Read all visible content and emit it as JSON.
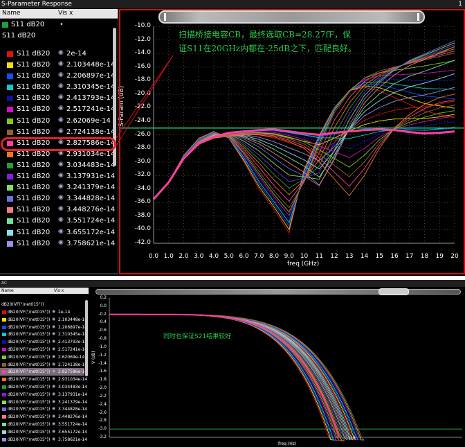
{
  "top_window": {
    "title": "S-Parameter Response",
    "window_number": "1",
    "list_header": {
      "name": "Name",
      "vis": "Vis x"
    },
    "group_top": "S11 dB20",
    "group_sub": "S11 dB20",
    "group_top_marker": "•",
    "rows": [
      {
        "name": "S11 dB20",
        "value": "2e-14",
        "color": "#e01010"
      },
      {
        "name": "S11 dB20",
        "value": "2.103448e-14",
        "color": "#f0e010"
      },
      {
        "name": "S11 dB20",
        "value": "2.206897e-14",
        "color": "#1050ff"
      },
      {
        "name": "S11 dB20",
        "value": "2.310345e-14",
        "color": "#10c8c8"
      },
      {
        "name": "S11 dB20",
        "value": "2.413793e-14",
        "color": "#1010a0"
      },
      {
        "name": "S11 dB20",
        "value": "2.517241e-14",
        "color": "#d010c8"
      },
      {
        "name": "S11 dB20",
        "value": "2.62069e-14",
        "color": "#80c820"
      },
      {
        "name": "S11 dB20",
        "value": "2.724138e-14",
        "color": "#8c6428"
      },
      {
        "name": "S11 dB20",
        "value": "2.827586e-14",
        "color": "#ff40a0",
        "selected": true
      },
      {
        "name": "S11 dB20",
        "value": "2.931034e-14",
        "color": "#f07818"
      },
      {
        "name": "S11 dB20",
        "value": "3.034483e-14",
        "color": "#20a040"
      },
      {
        "name": "S11 dB20",
        "value": "3.137931e-14",
        "color": "#8020e0"
      },
      {
        "name": "S11 dB20",
        "value": "3.241379e-14",
        "color": "#80e060"
      },
      {
        "name": "S11 dB20",
        "value": "3.344828e-14",
        "color": "#7070e0"
      },
      {
        "name": "S11 dB20",
        "value": "3.448276e-14",
        "color": "#f08080"
      },
      {
        "name": "S11 dB20",
        "value": "3.551724e-14",
        "color": "#70e0a0"
      },
      {
        "name": "S11 dB20",
        "value": "3.655172e-14",
        "color": "#8ce0f0"
      },
      {
        "name": "S11 dB20",
        "value": "3.758621e-14",
        "color": "#a08cf0"
      }
    ],
    "annotation_line1": "扫描桥接电容CB，最终选取CB=28.27fF，保",
    "annotation_line2": "证S11在20GHz内都在-25dB之下，匹配良好。",
    "colors": {
      "accent_ring": "#e8202a",
      "threshold_line": "#20d070",
      "selected_trace": "#ff40a0",
      "border": "#d01020"
    }
  },
  "bottom_window": {
    "title": "AC",
    "list_header": {
      "name": "Name",
      "vis": "Vis x"
    },
    "group_label": "dB20(VF(\"/net015\"))",
    "rows": [
      {
        "name": "dB20(VF(\"/net015\"))",
        "value": "2e-14",
        "color": "#e01010"
      },
      {
        "name": "dB20(VF(\"/net015\"))",
        "value": "2.103448e-14",
        "color": "#f0e010"
      },
      {
        "name": "dB20(VF(\"/net015\"))",
        "value": "2.206897e-14",
        "color": "#1050ff"
      },
      {
        "name": "dB20(VF(\"/net015\"))",
        "value": "2.310345e-14",
        "color": "#10c8c8"
      },
      {
        "name": "dB20(VF(\"/net015\"))",
        "value": "2.413793e-14",
        "color": "#1010a0"
      },
      {
        "name": "dB20(VF(\"/net015\"))",
        "value": "2.517241e-14",
        "color": "#d010c8"
      },
      {
        "name": "dB20(VF(\"/net015\"))",
        "value": "2.62069e-14",
        "color": "#80c820"
      },
      {
        "name": "dB20(VF(\"/net015\"))",
        "value": "2.724138e-14",
        "color": "#8c6428"
      },
      {
        "name": "dB20(VF(\"/net015\"))",
        "value": "2.827586e-14",
        "color": "#ff40a0",
        "selected": true
      },
      {
        "name": "dB20(VF(\"/net015\"))",
        "value": "2.931034e-14",
        "color": "#f07818"
      },
      {
        "name": "dB20(VF(\"/net015\"))",
        "value": "3.034483e-14",
        "color": "#20a040"
      },
      {
        "name": "dB20(VF(\"/net015\"))",
        "value": "3.137931e-14",
        "color": "#8020e0"
      },
      {
        "name": "dB20(VF(\"/net015\"))",
        "value": "3.241379e-14",
        "color": "#80e060"
      },
      {
        "name": "dB20(VF(\"/net015\"))",
        "value": "3.344828e-14",
        "color": "#7070e0"
      },
      {
        "name": "dB20(VF(\"/net015\"))",
        "value": "3.448276e-14",
        "color": "#f08080"
      },
      {
        "name": "dB20(VF(\"/net015\"))",
        "value": "3.551724e-14",
        "color": "#70e0a0"
      },
      {
        "name": "dB20(VF(\"/net015\"))",
        "value": "3.655172e-14",
        "color": "#8ce0f0"
      },
      {
        "name": "dB20(VF(\"/net015\"))",
        "value": "3.758621e-14",
        "color": "#a08cf0"
      }
    ],
    "annotation": "同时也保证S21结果较好",
    "x_tick_exponent": "10"
  },
  "chart_data": [
    {
      "type": "line",
      "title": "",
      "xlabel": "freq (GHz)",
      "ylabel": "S-Param (dB)",
      "xlim": [
        0,
        20
      ],
      "ylim": [
        -42,
        -10
      ],
      "x_ticks": [
        "0.0",
        "1.0",
        "2.0",
        "3.0",
        "4.0",
        "5.0",
        "6.0",
        "7.0",
        "8.0",
        "9.0",
        "10",
        "11",
        "12",
        "13",
        "14",
        "15",
        "16",
        "17",
        "18",
        "19",
        "20"
      ],
      "y_ticks": [
        "-10.0",
        "-12.0",
        "-14.0",
        "-16.0",
        "-18.0",
        "-20.0",
        "-22.0",
        "-24.0",
        "-26.0",
        "-28.0",
        "-30.0",
        "-32.0",
        "-34.0",
        "-36.0",
        "-38.0",
        "-40.0",
        "-42.0"
      ],
      "threshold": -25,
      "grid": true,
      "x": [
        0,
        1,
        2,
        3,
        4,
        5,
        6,
        7,
        8,
        9,
        10,
        11,
        12,
        13,
        14,
        15,
        16,
        17,
        18,
        19,
        20
      ],
      "series": [
        {
          "values": [
            -35.5,
            -33,
            -29,
            -26.5,
            -25.5,
            -26.5,
            -30,
            -34,
            -37,
            -40.5,
            -31,
            -26,
            -22,
            -19.5,
            -19,
            -19.5,
            -20.5,
            -21.5,
            -22.5,
            -23,
            -23.5
          ]
        },
        {
          "values": [
            -35.5,
            -33,
            -29.5,
            -27,
            -25.8,
            -26.2,
            -28.5,
            -31.5,
            -34.5,
            -37,
            -33,
            -27.5,
            -22.5,
            -19.5,
            -17.5,
            -16.5,
            -16,
            -15.5,
            -15,
            -14.5,
            -14
          ]
        },
        {
          "values": [
            -35.5,
            -33,
            -29.5,
            -27.2,
            -26,
            -25.8,
            -26.5,
            -27.5,
            -29,
            -30.5,
            -32,
            -34,
            -30,
            -25,
            -21,
            -18.5,
            -16.5,
            -15,
            -14,
            -13,
            -12
          ]
        },
        {
          "values": [
            -35.5,
            -33,
            -29.5,
            -27.3,
            -26.3,
            -25.7,
            -25.5,
            -25.3,
            -25.2,
            -25.5,
            -25.8,
            -26,
            -25.7,
            -25.5,
            -25.3,
            -25.2,
            -25.3,
            -25.6,
            -25.8,
            -25.7,
            -25.5
          ]
        },
        {
          "values": [
            -35.5,
            -33,
            -29.5,
            -27.4,
            -26.5,
            -26.2,
            -26,
            -26,
            -26.3,
            -27,
            -28,
            -30,
            -32.5,
            -35,
            -32,
            -28,
            -25,
            -23,
            -21.5,
            -20.5,
            -20
          ]
        }
      ]
    },
    {
      "type": "line",
      "title": "",
      "xlabel": "freq (Hz)",
      "ylabel": "V (dB)",
      "ylim": [
        -3.2,
        0.2
      ],
      "y_ticks": [
        "0.2",
        "0.0",
        "-0.2",
        "-0.4",
        "-0.6",
        "-0.8",
        "-1.0",
        "-1.2",
        "-1.4",
        "-1.6",
        "-1.8",
        "-2.0",
        "-2.2",
        "-2.4",
        "-2.6",
        "-2.8",
        "-3.0",
        "-3.2"
      ],
      "threshold": -3.0,
      "grid": false
    }
  ]
}
